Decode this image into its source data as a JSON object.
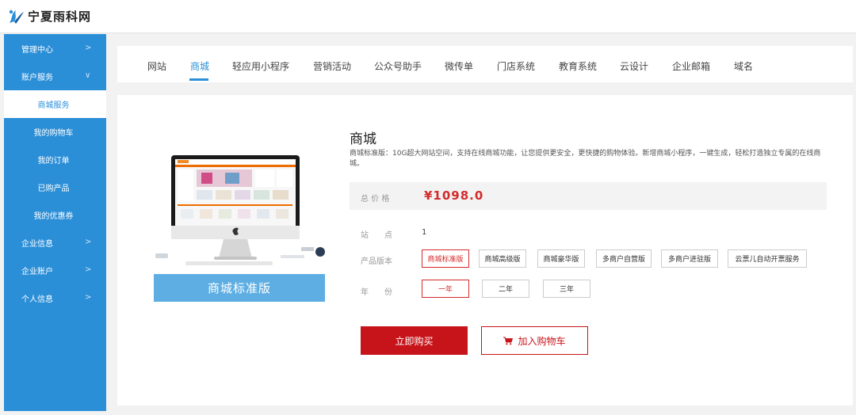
{
  "brand": {
    "logo_text": "宁夏雨科网"
  },
  "sidebar": {
    "items": [
      {
        "label": "管理中心",
        "chevron": ">"
      },
      {
        "label": "账户服务",
        "chevron": "∨"
      }
    ],
    "sub_items": [
      {
        "label": "商城服务"
      },
      {
        "label": "我的购物车"
      },
      {
        "label": "我的订单"
      },
      {
        "label": "已购产品"
      },
      {
        "label": "我的优惠券"
      }
    ],
    "bottom_items": [
      {
        "label": "企业信息",
        "chevron": ">"
      },
      {
        "label": "企业账户",
        "chevron": ">"
      },
      {
        "label": "个人信息",
        "chevron": ">"
      }
    ]
  },
  "tabs": [
    {
      "label": "网站"
    },
    {
      "label": "商城"
    },
    {
      "label": "轻应用小程序"
    },
    {
      "label": "营销活动"
    },
    {
      "label": "公众号助手"
    },
    {
      "label": "微传单"
    },
    {
      "label": "门店系统"
    },
    {
      "label": "教育系统"
    },
    {
      "label": "云设计"
    },
    {
      "label": "企业邮箱"
    },
    {
      "label": "域名"
    }
  ],
  "product": {
    "title": "商城",
    "description": "商城标准版：10G超大网站空间，支持在线商城功能，让您提供更安全，更快捷的购物体验。新增商城小程序，一键生成，轻松打造独立专属的在线商城。",
    "image_caption": "商城标准版",
    "price_label": "总 价 格",
    "price": "¥1098.0",
    "site_label": "站　　点",
    "site_value": "1",
    "version_label": "产品版本",
    "versions": [
      {
        "label": "商城标准版"
      },
      {
        "label": "商城高级版"
      },
      {
        "label": "商城豪华版"
      },
      {
        "label": "多商户自营版"
      },
      {
        "label": "多商户进驻版"
      },
      {
        "label": "云票儿自动开票服务"
      }
    ],
    "year_label": "年　　份",
    "years": [
      {
        "label": "一年"
      },
      {
        "label": "二年"
      },
      {
        "label": "三年"
      }
    ],
    "buy_label": "立即购买",
    "cart_label": "加入购物车"
  },
  "colors": {
    "accent": "#2b8fd8",
    "buy": "#c7141a",
    "selected": "#d42b2b"
  },
  "icons": {
    "logo": "yuke-logo-icon",
    "cart": "cart-icon"
  }
}
